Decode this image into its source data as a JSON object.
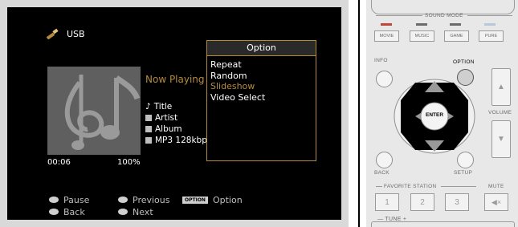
{
  "screen": {
    "source": "USB",
    "now_playing": "Now Playing",
    "meta": {
      "title": "Title",
      "artist": "Artist",
      "album": "Album",
      "format": "MP3 128kbps"
    },
    "time": "00:06",
    "percent": "100%",
    "option_popup": {
      "title": "Option",
      "items": [
        "Repeat",
        "Random",
        "Slideshow",
        "Video Select"
      ],
      "selected_index": 2
    },
    "footer": {
      "pause": "Pause",
      "back": "Back",
      "previous": "Previous",
      "next": "Next",
      "option_badge": "OPTION",
      "option": "Option"
    }
  },
  "remote": {
    "sound_mode": "SOUND MODE",
    "modes": [
      "MOVIE",
      "MUSIC",
      "GAME",
      "PURE"
    ],
    "info": "INFO",
    "option": "OPTION",
    "enter": "ENTER",
    "volume": "VOLUME",
    "back": "BACK",
    "setup": "SETUP",
    "favorite": "FAVORITE STATION",
    "mute": "MUTE",
    "numbers": [
      "1",
      "2",
      "3"
    ],
    "tune": "TUNE"
  },
  "colors": {
    "accent": "#b58a3c",
    "screen_bg": "#000000",
    "remote_bg": "#e8e8e8"
  }
}
